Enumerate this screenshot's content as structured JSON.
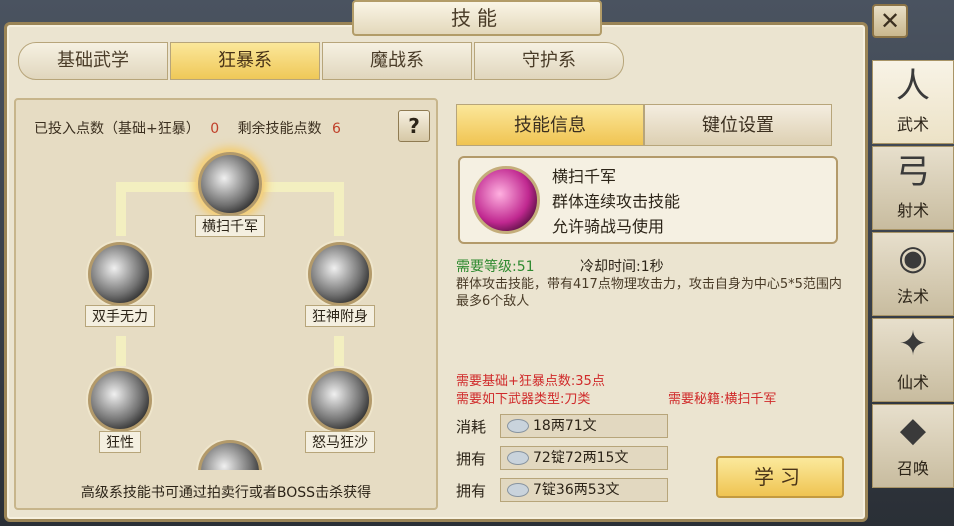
{
  "window": {
    "title": "技能",
    "close_label": "✕"
  },
  "tabs": [
    "基础武学",
    "狂暴系",
    "魔战系",
    "守护系"
  ],
  "left": {
    "invested_label": "已投入点数（基础+狂暴）",
    "invested_value": "0",
    "remaining_label": "剩余技能点数",
    "remaining_value": "6",
    "help_label": "?",
    "skills": [
      "横扫千军",
      "双手无力",
      "狂神附身",
      "狂性",
      "怒马狂沙"
    ],
    "footer_note": "高级系技能书可通过拍卖行或者BOSS击杀获得"
  },
  "right": {
    "tabs": [
      "技能信息",
      "键位设置"
    ],
    "skill": {
      "name": "横扫千军",
      "line1": "群体连续攻击技能",
      "line2": "允许骑战马使用"
    },
    "req_level": "需要等级:51",
    "cooldown": "冷却时间:1秒",
    "description": "群体攻击技能，带有417点物理攻击力，攻击自身为中心5*5范围内最多6个敌人",
    "req_points": "需要基础+狂暴点数:35点",
    "req_weapon": "需要如下武器类型:刀类",
    "req_book": "需要秘籍:横扫千军",
    "costs": [
      {
        "label": "消耗",
        "value": "18两71文"
      },
      {
        "label": "拥有",
        "value": "72锭72两15文"
      },
      {
        "label": "拥有",
        "value": "7锭36两53文"
      }
    ],
    "learn_label": "学习"
  },
  "sidebar": [
    {
      "icon": "martial-icon",
      "label": "武术"
    },
    {
      "icon": "archery-icon",
      "label": "射术"
    },
    {
      "icon": "gourd-icon",
      "label": "法术"
    },
    {
      "icon": "shuriken-icon",
      "label": "仙术"
    },
    {
      "icon": "demon-icon",
      "label": "召唤"
    }
  ]
}
